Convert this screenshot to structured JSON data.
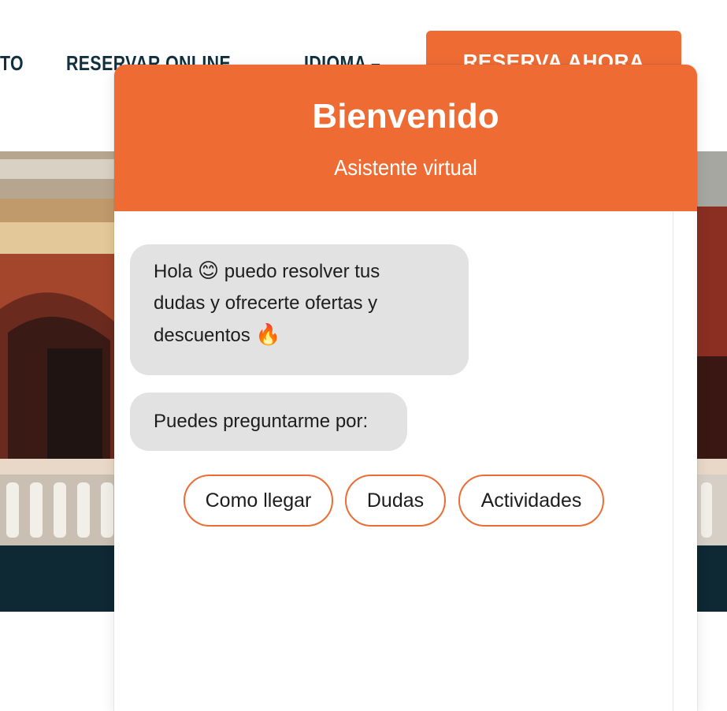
{
  "site_nav": {
    "partial_item": "TO",
    "reservar_online": "RESERVAR ONLINE",
    "idioma": "IDIOMA –",
    "cta": "RESERVA AHORA"
  },
  "chat": {
    "title": "Bienvenido",
    "subtitle": "Asistente virtual",
    "messages": [
      {
        "line1_pre": "Hola ",
        "line1_emoji": "😊",
        "line1_post": " puedo resolver tus",
        "line2": "dudas y ofrecerte ofertas y",
        "line3_pre": "descuentos ",
        "line3_emoji": "🔥"
      },
      {
        "text": "Puedes preguntarme por:"
      }
    ],
    "quick_replies": [
      "Como llegar",
      "Dudas",
      "Actividades"
    ]
  },
  "colors": {
    "accent": "#ee6c33",
    "nav_text": "#10303f",
    "bubble_bg": "#e2e2e2",
    "dark_band": "#0e2834"
  },
  "icons": [
    "smiling-face-emoji",
    "fire-emoji"
  ]
}
